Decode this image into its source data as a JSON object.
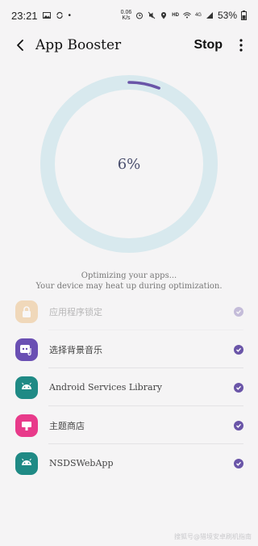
{
  "status_bar": {
    "time": "23:21",
    "net_speed_top": "0.06",
    "net_speed_unit": "K/s",
    "battery_percent": "53%",
    "hd_label": "HD",
    "net_type": "4G"
  },
  "header": {
    "title": "App Booster",
    "stop_label": "Stop"
  },
  "progress": {
    "value": 6,
    "label": "6%",
    "track_color": "#d8e9ee",
    "fill_color": "#6a55a8"
  },
  "messages": {
    "line1": "Optimizing your apps...",
    "line2": "Your device may heat up during optimization."
  },
  "apps": [
    {
      "name": "应用程序锁定",
      "icon": "lock-app-icon",
      "color": "#e8a64e",
      "dimmed": true
    },
    {
      "name": "选择背景音乐",
      "icon": "music-app-icon",
      "color": "#6a4fb3",
      "dimmed": false
    },
    {
      "name": "Android Services Library",
      "icon": "android-app-icon",
      "color": "#1f8a85",
      "dimmed": false
    },
    {
      "name": "主题商店",
      "icon": "theme-store-icon",
      "color": "#e83a8a",
      "dimmed": false
    },
    {
      "name": "NSDSWebApp",
      "icon": "android-app-icon",
      "color": "#1f8a85",
      "dimmed": false
    }
  ],
  "check_color": "#6a55a8",
  "watermark": "搜狐号@猎境安卓刷机指南"
}
